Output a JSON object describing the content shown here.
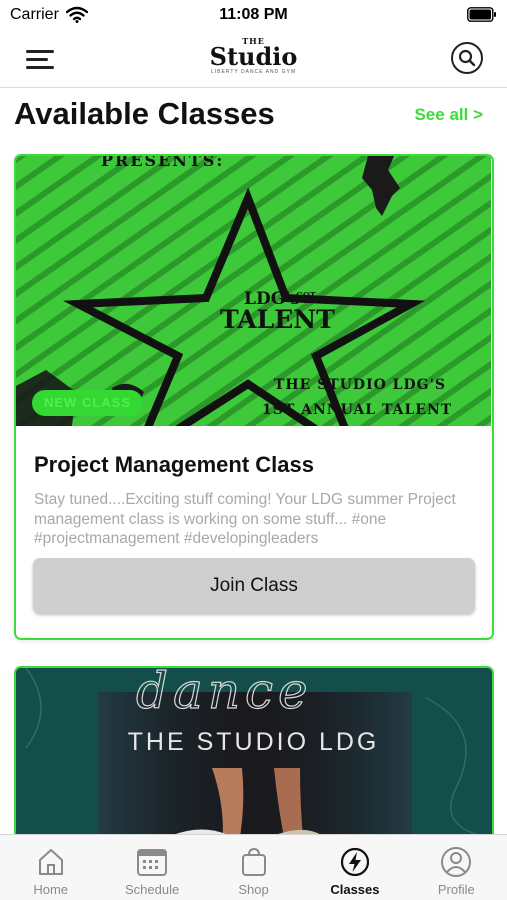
{
  "status_bar": {
    "carrier": "Carrier",
    "time": "11:08 PM"
  },
  "header": {
    "logo_top": "THE",
    "logo_main": "Studio",
    "logo_sub": "LIBERTY DANCE AND GYM"
  },
  "section": {
    "title": "Available Classes",
    "see_all": "See all >"
  },
  "classes": [
    {
      "badge": "NEW CLASS",
      "title": "Project Management Class",
      "description": "Stay tuned....Exciting stuff coming! Your LDG summer Project management class is working on some stuff... #one #projectmanagement #developingleaders",
      "join_label": "Join Class",
      "poster": {
        "presents": "PRESENTS:",
        "star_line1": "LDG's",
        "star_line1b": "GOT",
        "star_line2": "TALENT",
        "bottom_line1": "THE STUDIO LDG'S",
        "bottom_line2": "1ST ANNUAL TALENT"
      }
    },
    {
      "poster": {
        "script": "dance",
        "text": "THE STUDIO LDG"
      }
    }
  ],
  "tabs": [
    {
      "label": "Home",
      "icon": "home-icon",
      "active": false
    },
    {
      "label": "Schedule",
      "icon": "calendar-icon",
      "active": false
    },
    {
      "label": "Shop",
      "icon": "shopping-bag-icon",
      "active": false
    },
    {
      "label": "Classes",
      "icon": "lightning-icon",
      "active": true
    },
    {
      "label": "Profile",
      "icon": "profile-icon",
      "active": false
    }
  ],
  "colors": {
    "accent": "#3ddc3a",
    "card2_bg": "#134e4a",
    "button_bg": "#cfcfcf"
  }
}
